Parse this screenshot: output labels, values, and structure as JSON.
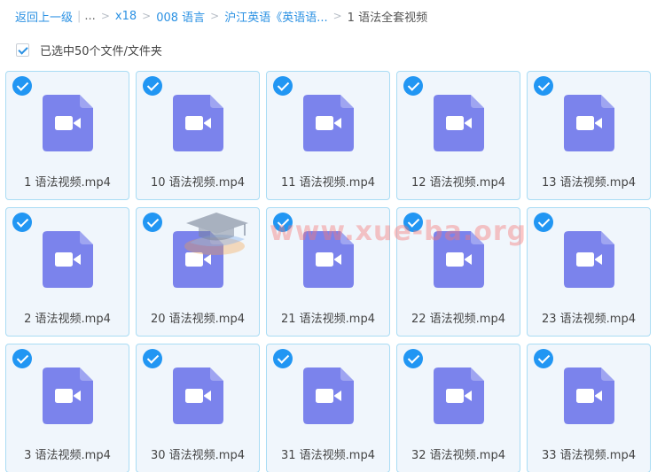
{
  "breadcrumb": {
    "back": "返回上一级",
    "bar": "|",
    "ellipsis": "...",
    "sep": ">",
    "items": [
      "x18",
      "008 语言",
      "沪江英语《英语语..."
    ],
    "current": "1 语法全套视频"
  },
  "selection": {
    "label": "已选中50个文件/文件夹",
    "checked": true
  },
  "files": [
    {
      "name": "1 语法视频.mp4",
      "selected": true
    },
    {
      "name": "10 语法视频.mp4",
      "selected": true
    },
    {
      "name": "11 语法视频.mp4",
      "selected": true
    },
    {
      "name": "12 语法视频.mp4",
      "selected": true
    },
    {
      "name": "13 语法视频.mp4",
      "selected": true
    },
    {
      "name": "2 语法视频.mp4",
      "selected": true
    },
    {
      "name": "20 语法视频.mp4",
      "selected": true
    },
    {
      "name": "21 语法视频.mp4",
      "selected": true
    },
    {
      "name": "22 语法视频.mp4",
      "selected": true
    },
    {
      "name": "23 语法视频.mp4",
      "selected": true
    },
    {
      "name": "3 语法视频.mp4",
      "selected": true
    },
    {
      "name": "30 语法视频.mp4",
      "selected": true
    },
    {
      "name": "31 语法视频.mp4",
      "selected": true
    },
    {
      "name": "32 语法视频.mp4",
      "selected": true
    },
    {
      "name": "33 语法视频.mp4",
      "selected": true
    }
  ],
  "watermark": {
    "text": "www.xue-ba.org",
    "icon": "graduation-cap-icon"
  },
  "colors": {
    "accent": "#2b91e3",
    "check": "#2196f3",
    "video_icon": "#7b83ec",
    "card_bg": "#f0f6fc",
    "card_border": "#a9dcf4"
  }
}
